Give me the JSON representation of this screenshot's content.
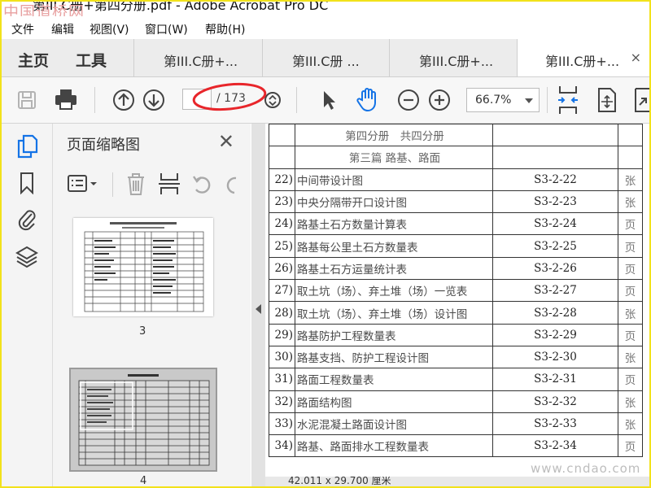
{
  "watermark_top": "中国道桥网",
  "window": {
    "title": "第III.C册+第四分册.pdf - Adobe Acrobat Pro DC"
  },
  "menu": [
    "文件",
    "编辑",
    "视图(V)",
    "窗口(W)",
    "帮助(H)"
  ],
  "tabs": {
    "home": "主页",
    "tools": "工具",
    "docs": [
      "第III.C册+...",
      "第III.C册 ...",
      "第III.C册+...",
      "第III.C册+..."
    ],
    "close": "×"
  },
  "toolbar": {
    "page_value": "",
    "page_total": "/ 173",
    "zoom": "66.7%"
  },
  "thumb_panel": {
    "title": "页面缩略图",
    "close": "✕",
    "pages": [
      "3",
      "4"
    ]
  },
  "document": {
    "header1": "第四分册　共四分册",
    "header2": "第三篇 路基、路面",
    "rows": [
      {
        "no": "22)",
        "title": "中间带设计图",
        "code": "S3-2-22",
        "unit": "张"
      },
      {
        "no": "23)",
        "title": "中央分隔带开口设计图",
        "code": "S3-2-23",
        "unit": "张"
      },
      {
        "no": "24)",
        "title": "路基土石方数量计算表",
        "code": "S3-2-24",
        "unit": "页"
      },
      {
        "no": "25)",
        "title": "路基每公里土石方数量表",
        "code": "S3-2-25",
        "unit": "页"
      },
      {
        "no": "26)",
        "title": "路基土石方运量统计表",
        "code": "S3-2-26",
        "unit": "页"
      },
      {
        "no": "27)",
        "title": "取土坑（场）、弃土堆（场）一览表",
        "code": "S3-2-27",
        "unit": "页"
      },
      {
        "no": "28)",
        "title": "取土坑（场）、弃土堆（场）设计图",
        "code": "S3-2-28",
        "unit": "张"
      },
      {
        "no": "29)",
        "title": "路基防护工程数量表",
        "code": "S3-2-29",
        "unit": "页"
      },
      {
        "no": "30)",
        "title": "路基支挡、防护工程设计图",
        "code": "S3-2-30",
        "unit": "张"
      },
      {
        "no": "31)",
        "title": "路面工程数量表",
        "code": "S3-2-31",
        "unit": "页"
      },
      {
        "no": "32)",
        "title": "路面结构图",
        "code": "S3-2-32",
        "unit": "张"
      },
      {
        "no": "33)",
        "title": "水泥混凝土路面设计图",
        "code": "S3-2-33",
        "unit": "张"
      },
      {
        "no": "34)",
        "title": "路基、路面排水工程数量表",
        "code": "S3-2-34",
        "unit": "页"
      }
    ]
  },
  "status": {
    "dimensions": "42.011 x 29.700 厘米"
  },
  "watermark_bottom": "www.cndao.com",
  "colors": {
    "accent": "#1473e6",
    "annotation": "#e8262b",
    "border": "#f2e21b"
  }
}
